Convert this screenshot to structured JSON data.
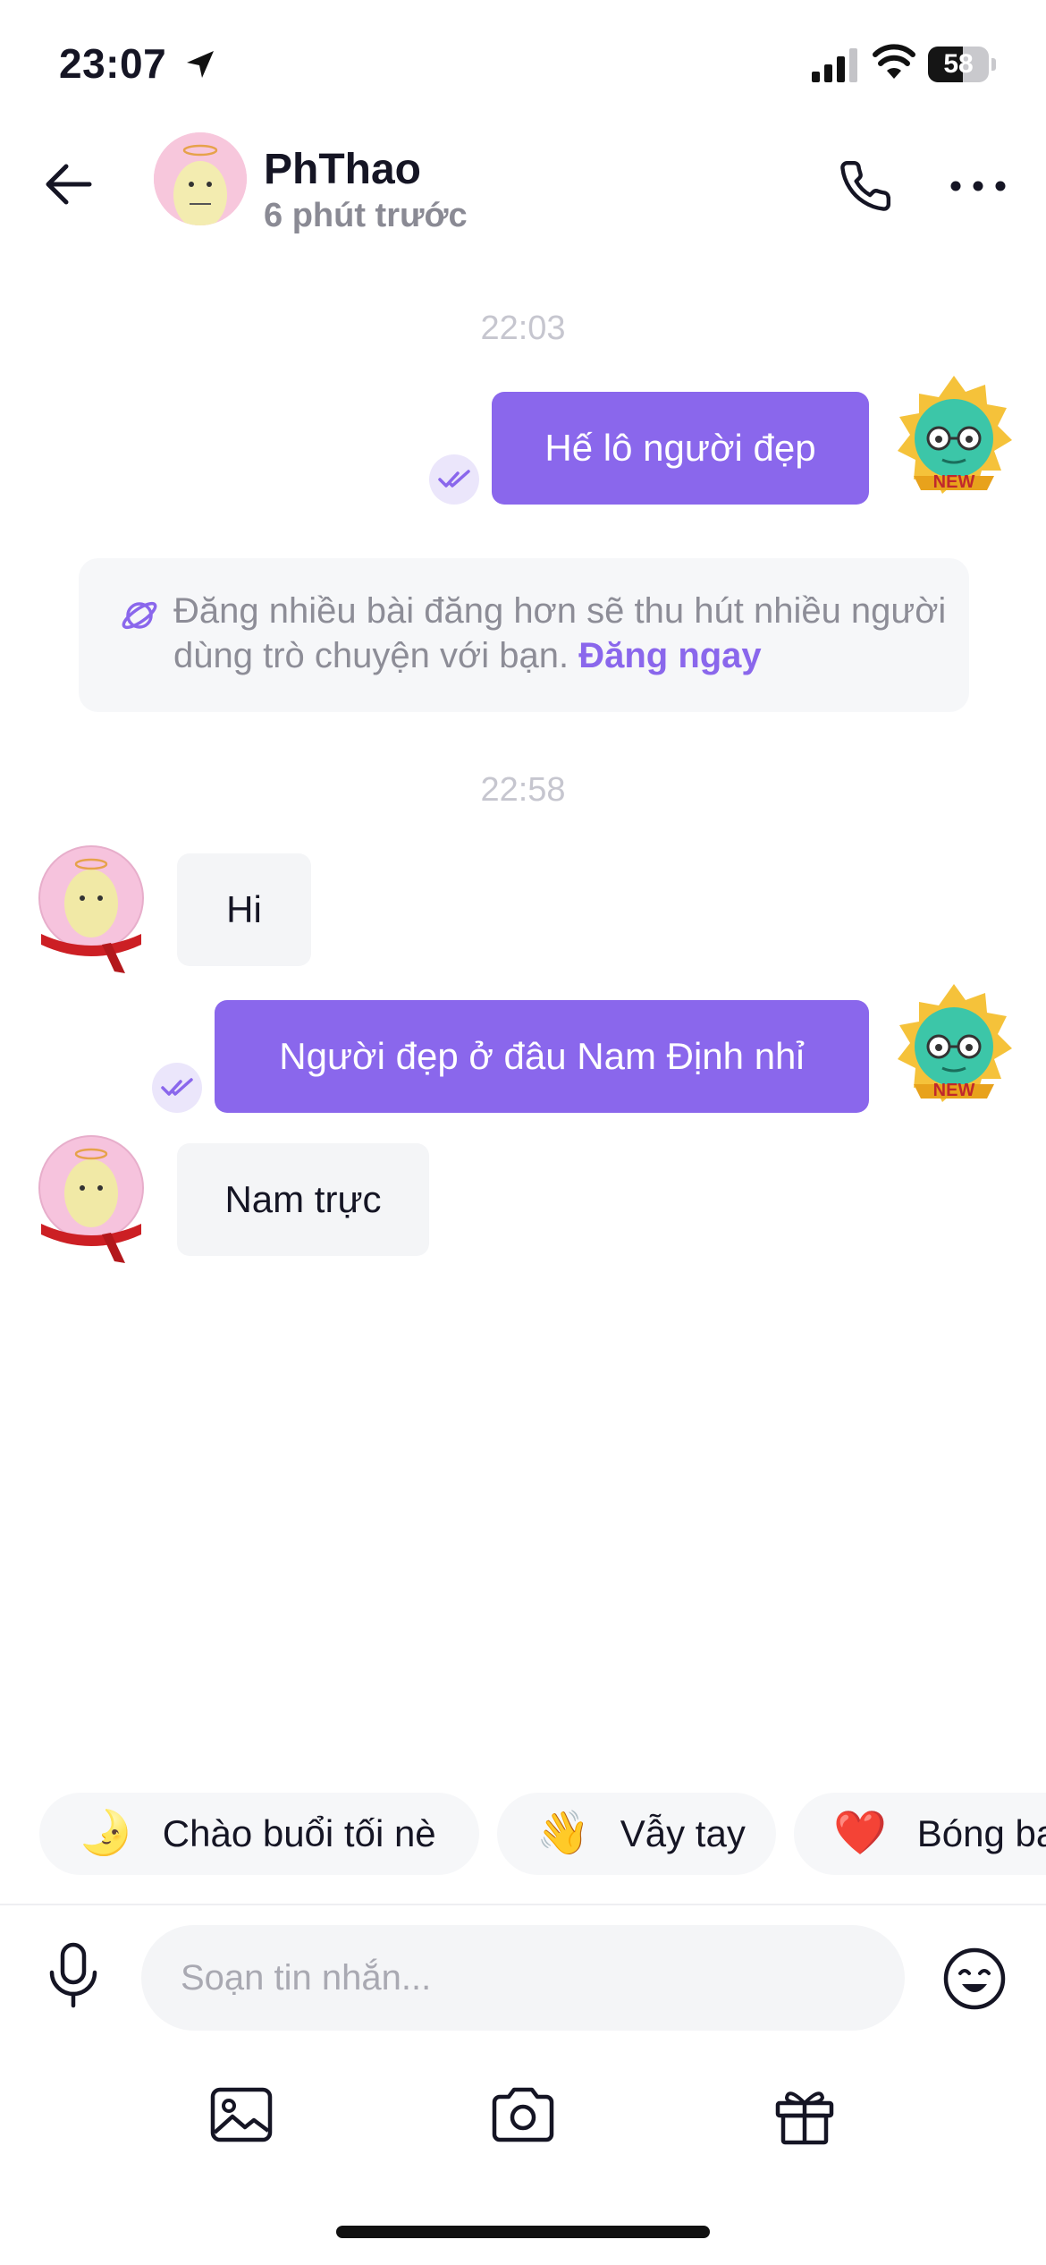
{
  "status_bar": {
    "time": "23:07",
    "battery": "58"
  },
  "header": {
    "name": "PhThao",
    "last_seen": "6 phút trước"
  },
  "messages": [
    {
      "type": "time",
      "text": "22:03"
    },
    {
      "type": "out",
      "text": "Hế lô người đẹp",
      "read": true
    },
    {
      "type": "tip",
      "text": "Đăng nhiều bài đăng hơn sẽ thu hút nhiều người dùng trò chuyện với bạn.",
      "link": "Đăng ngay"
    },
    {
      "type": "time",
      "text": "22:58"
    },
    {
      "type": "in",
      "text": "Hi"
    },
    {
      "type": "out",
      "text": "Người đẹp ở đâu Nam Định nhỉ",
      "read": true
    },
    {
      "type": "in",
      "text": "Nam trực"
    }
  ],
  "badges": {
    "new": "NEW"
  },
  "quick_replies": [
    {
      "emoji": "🌛",
      "label": "Chào buổi tối nè"
    },
    {
      "emoji": "👋",
      "label": "Vẫy tay"
    },
    {
      "emoji": "❤️",
      "label": "Bóng bay"
    }
  ],
  "composer": {
    "placeholder": "Soạn tin nhắn..."
  },
  "colors": {
    "accent": "#8a67ec",
    "bubble_in": "#f4f5f7",
    "muted": "#8a8a94"
  },
  "icons": {
    "back": "arrow-left-icon",
    "call": "phone-icon",
    "more": "more-horizontal-icon",
    "mic": "microphone-icon",
    "emoji": "emoji-icon",
    "image": "image-icon",
    "camera": "camera-icon",
    "gift": "gift-icon",
    "read": "double-check-icon",
    "tip": "planet-icon"
  }
}
